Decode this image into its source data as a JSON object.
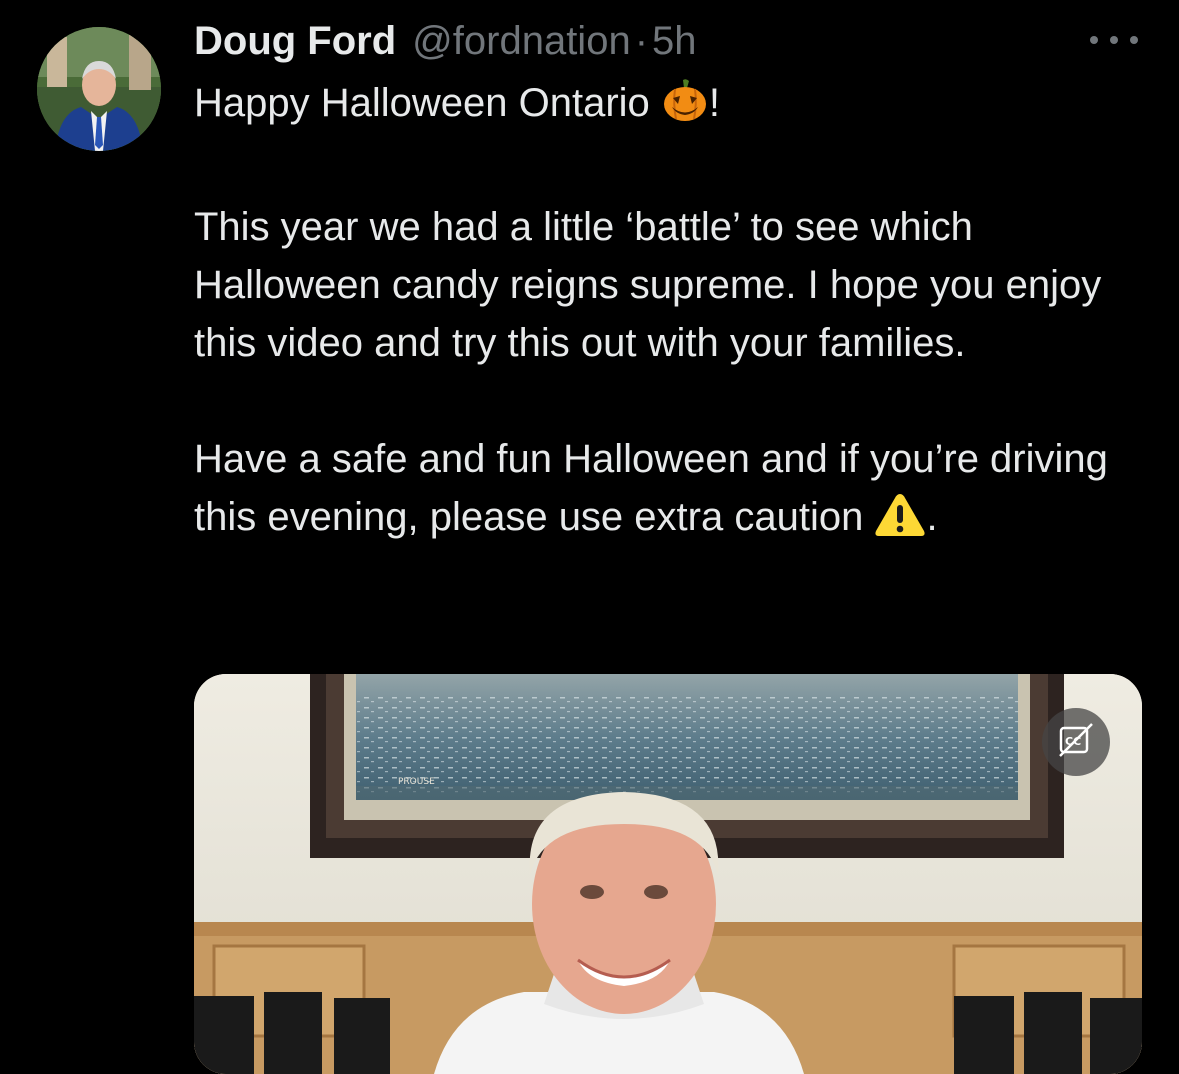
{
  "tweet": {
    "author_name": "Doug Ford",
    "handle": "@fordnation",
    "separator": "·",
    "time": "5h",
    "line1": "Happy Halloween Ontario ",
    "line1_end": "!",
    "paragraph2": "This year we had a little ‘battle’ to see which Halloween candy reigns supreme. I hope you enjoy this video and try this out with your families.",
    "paragraph3": "Have a safe and fun Halloween and if you’re driving this evening, please use extra caution ",
    "paragraph3_end": ".",
    "emoji_1": "jack-o-lantern-icon",
    "emoji_2": "warning-icon"
  },
  "media": {
    "type": "video",
    "painting_signature": "PROUSE",
    "cc_icon": "captions-off-icon"
  },
  "colors": {
    "background": "#000000",
    "text": "#e7e9ea",
    "secondary": "#71767b"
  }
}
